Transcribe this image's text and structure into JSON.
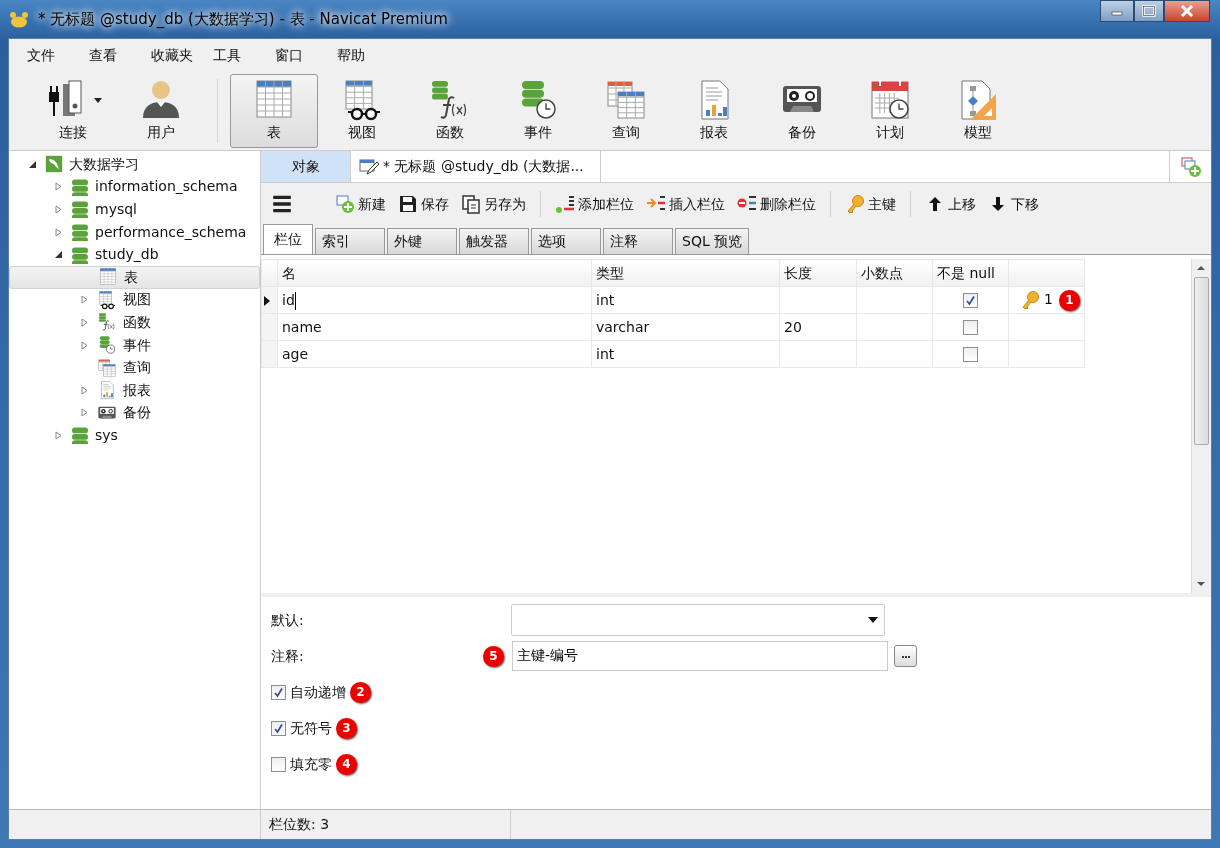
{
  "window": {
    "title": "* 无标题 @study_db (大数据学习) - 表 - Navicat Premium"
  },
  "menu": [
    "文件",
    "查看",
    "收藏夹",
    "工具",
    "窗口",
    "帮助"
  ],
  "toolbar": [
    {
      "label": "连接",
      "kind": "connect",
      "selected": false
    },
    {
      "label": "用户",
      "kind": "user",
      "selected": false
    },
    {
      "label": "表",
      "kind": "table",
      "selected": true
    },
    {
      "label": "视图",
      "kind": "view",
      "selected": false
    },
    {
      "label": "函数",
      "kind": "function",
      "selected": false
    },
    {
      "label": "事件",
      "kind": "event",
      "selected": false
    },
    {
      "label": "查询",
      "kind": "query",
      "selected": false
    },
    {
      "label": "报表",
      "kind": "report",
      "selected": false
    },
    {
      "label": "备份",
      "kind": "backup",
      "selected": false
    },
    {
      "label": "计划",
      "kind": "schedule",
      "selected": false
    },
    {
      "label": "模型",
      "kind": "model",
      "selected": false
    }
  ],
  "sidebar": {
    "tree": [
      {
        "label": "大数据学习",
        "kind": "connection",
        "expanded": true,
        "selected": false,
        "children": [
          {
            "label": "information_schema",
            "kind": "database",
            "expanded": false,
            "selected": false
          },
          {
            "label": "mysql",
            "kind": "database",
            "expanded": false,
            "selected": false
          },
          {
            "label": "performance_schema",
            "kind": "database",
            "expanded": false,
            "selected": false
          },
          {
            "label": "study_db",
            "kind": "database",
            "expanded": true,
            "selected": false,
            "children": [
              {
                "label": "表",
                "kind": "table",
                "selected": true
              },
              {
                "label": "视图",
                "kind": "view",
                "expanded": false,
                "selected": false
              },
              {
                "label": "函数",
                "kind": "function",
                "expanded": false,
                "selected": false
              },
              {
                "label": "事件",
                "kind": "event",
                "expanded": false,
                "selected": false
              },
              {
                "label": "查询",
                "kind": "query",
                "selected": false
              },
              {
                "label": "报表",
                "kind": "report",
                "expanded": false,
                "selected": false
              },
              {
                "label": "备份",
                "kind": "backup",
                "expanded": false,
                "selected": false
              }
            ]
          },
          {
            "label": "sys",
            "kind": "database",
            "expanded": false,
            "selected": false
          }
        ]
      }
    ]
  },
  "doc_tabs": [
    {
      "label": "对象",
      "kind": "objects",
      "selected": false
    },
    {
      "label": "* 无标题 @study_db (大数据...",
      "kind": "editor",
      "selected": true
    }
  ],
  "editor_toolbar": [
    {
      "kind": "menu"
    },
    {
      "label": "新建",
      "kind": "new"
    },
    {
      "label": "保存",
      "kind": "save"
    },
    {
      "label": "另存为",
      "kind": "saveas"
    },
    {
      "label": "添加栏位",
      "kind": "addcol"
    },
    {
      "label": "插入栏位",
      "kind": "inscol"
    },
    {
      "label": "删除栏位",
      "kind": "delcol"
    },
    {
      "label": "主键",
      "kind": "key"
    },
    {
      "label": "上移",
      "kind": "up"
    },
    {
      "label": "下移",
      "kind": "down"
    }
  ],
  "subtabs": [
    {
      "label": "栏位",
      "selected": true
    },
    {
      "label": "索引",
      "selected": false
    },
    {
      "label": "外键",
      "selected": false
    },
    {
      "label": "触发器",
      "selected": false
    },
    {
      "label": "选项",
      "selected": false
    },
    {
      "label": "注释",
      "selected": false
    },
    {
      "label": "SQL 预览",
      "selected": false
    }
  ],
  "table": {
    "columns": [
      "名",
      "类型",
      "长度",
      "小数点",
      "不是 null"
    ],
    "rows": [
      {
        "name": "id",
        "type": "int",
        "not_null": true,
        "key": "1",
        "current": true,
        "callout": "1"
      },
      {
        "name": "name",
        "type": "varchar",
        "length": "20",
        "not_null": false,
        "current": false
      },
      {
        "name": "age",
        "type": "int",
        "not_null": false,
        "current": false
      }
    ]
  },
  "properties": {
    "default": {
      "label": "默认:"
    },
    "comment": {
      "label": "注释:",
      "value": "主键-编号",
      "callout": "5"
    },
    "options": [
      {
        "label": "自动递增",
        "checked": true,
        "callout": "2"
      },
      {
        "label": "无符号",
        "checked": true,
        "callout": "3"
      },
      {
        "label": "填充零",
        "checked": false,
        "callout": "4"
      }
    ]
  },
  "status_bar": [
    "栏位数: 3"
  ]
}
